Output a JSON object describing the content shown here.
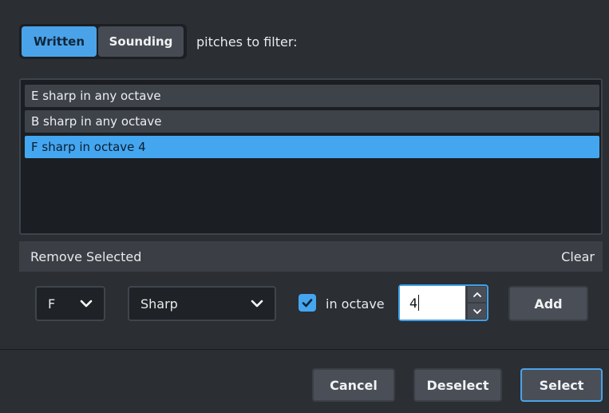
{
  "mode_toggle": {
    "written": "Written",
    "sounding": "Sounding",
    "suffix": "pitches to filter:"
  },
  "pitch_list": [
    {
      "label": "E sharp in any octave",
      "selected": false
    },
    {
      "label": "B sharp in any octave",
      "selected": false
    },
    {
      "label": "F sharp in octave 4",
      "selected": true
    }
  ],
  "list_actions": {
    "remove": "Remove Selected",
    "clear": "Clear"
  },
  "controls": {
    "note_value": "F",
    "accidental_value": "Sharp",
    "in_octave_checked": true,
    "in_octave_label": "in octave",
    "octave_value": "4",
    "add_label": "Add"
  },
  "footer": {
    "cancel": "Cancel",
    "deselect": "Deselect",
    "select": "Select"
  },
  "colors": {
    "accent": "#45a6f0",
    "background": "#2b2e33"
  }
}
